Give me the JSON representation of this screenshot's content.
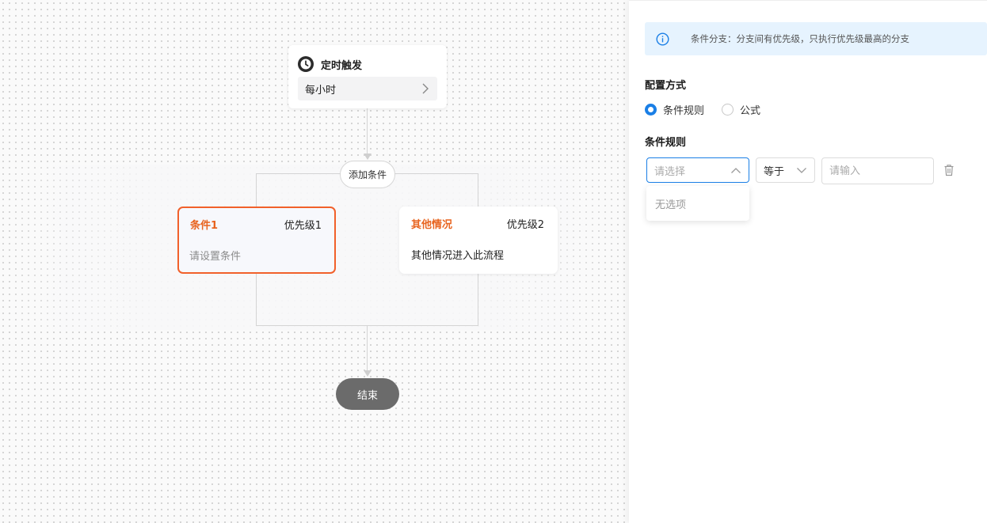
{
  "flow": {
    "trigger": {
      "title": "定时触发",
      "schedule": "每小时"
    },
    "add_condition_label": "添加条件",
    "branches": [
      {
        "name": "条件1",
        "priority": "优先级1",
        "description": "请设置条件",
        "selected": true
      },
      {
        "name": "其他情况",
        "priority": "优先级2",
        "description": "其他情况进入此流程",
        "selected": false
      }
    ],
    "end_label": "结束"
  },
  "panel": {
    "tip": "条件分支：分支间有优先级，只执行优先级最高的分支",
    "config_title": "配置方式",
    "config_options": [
      {
        "label": "条件规则",
        "checked": true
      },
      {
        "label": "公式",
        "checked": false
      }
    ],
    "rules_title": "条件规则",
    "rule": {
      "field_placeholder": "请选择",
      "operator": "等于",
      "value_placeholder": "请输入"
    },
    "dropdown_empty": "无选项"
  },
  "colors": {
    "accent": "#1a7fe6",
    "branch_active_border": "#f1602a",
    "branch_name": "#e8641f",
    "end_node": "#6b6b6b",
    "tip_background": "#e6f3fe"
  }
}
